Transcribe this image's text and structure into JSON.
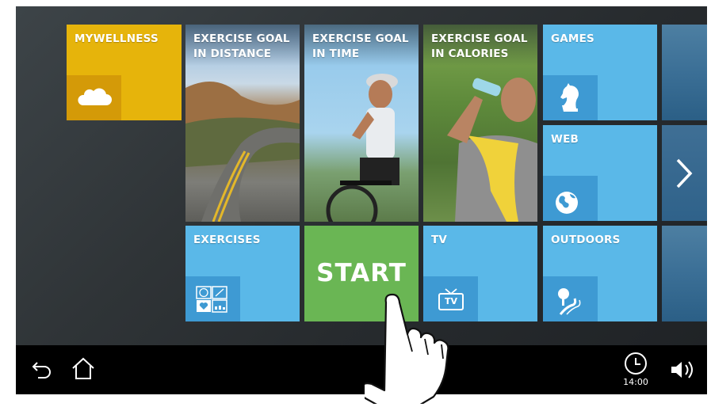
{
  "tiles": {
    "mywellness": {
      "label": "MYWELLNESS",
      "icon": "cloud-icon"
    },
    "distance": {
      "label": "EXERCISE GOAL\nIN DISTANCE"
    },
    "time": {
      "label": "EXERCISE GOAL\nIN TIME"
    },
    "calories": {
      "label": "EXERCISE GOAL\nIN CALORIES"
    },
    "games": {
      "label": "GAMES",
      "icon": "chess-knight-icon"
    },
    "web": {
      "label": "WEB",
      "icon": "globe-icon"
    },
    "exercises": {
      "label": "EXERCISES",
      "icon": "exercises-grid-icon"
    },
    "start": {
      "label": "START"
    },
    "tv": {
      "label": "TV",
      "icon": "tv-icon",
      "icon_text": "TV"
    },
    "outdoors": {
      "label": "OUTDOORS",
      "icon": "outdoors-icon"
    }
  },
  "navbar": {
    "back_icon": "back-icon",
    "home_icon": "home-icon",
    "clock_icon": "clock-icon",
    "time": "14:00",
    "volume_icon": "volume-icon"
  },
  "colors": {
    "mywellness": "#e6b40b",
    "light_blue": "#5ab8e8",
    "icon_blue": "#3e9ad3",
    "start_green": "#6ab654",
    "navbar": "#000000"
  }
}
